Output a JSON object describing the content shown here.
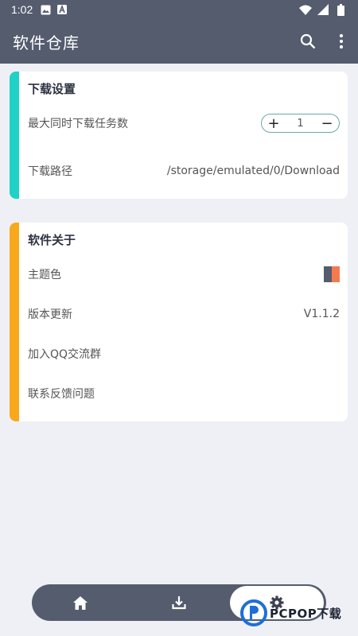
{
  "status_bar": {
    "time": "1:02",
    "icons": [
      "image-icon",
      "font-icon",
      "wifi-icon",
      "signal-icon",
      "battery-icon"
    ]
  },
  "app_bar": {
    "title": "软件仓库",
    "actions": [
      "search-icon",
      "more-vert-icon"
    ]
  },
  "download_settings": {
    "heading": "下载设置",
    "accent_color": "#1fd1c6",
    "max_tasks_label": "最大同时下载任务数",
    "max_tasks_value": "1",
    "plus_label": "+",
    "minus_label": "−",
    "path_label": "下载路径",
    "path_value": "/storage/emulated/0/Download"
  },
  "about": {
    "heading": "软件关于",
    "accent_color": "#f7a81b",
    "theme_label": "主题色",
    "theme_colors": [
      "#545c6e",
      "#f47a4d"
    ],
    "update_label": "版本更新",
    "version": "V1.1.2",
    "qq_group_label": "加入QQ交流群",
    "feedback_label": "联系反馈问题"
  },
  "bottom_nav": {
    "items": [
      "home-icon",
      "download-icon",
      "settings-icon"
    ],
    "selected": "settings-icon"
  },
  "watermark": {
    "text": "PCPOP下载"
  }
}
